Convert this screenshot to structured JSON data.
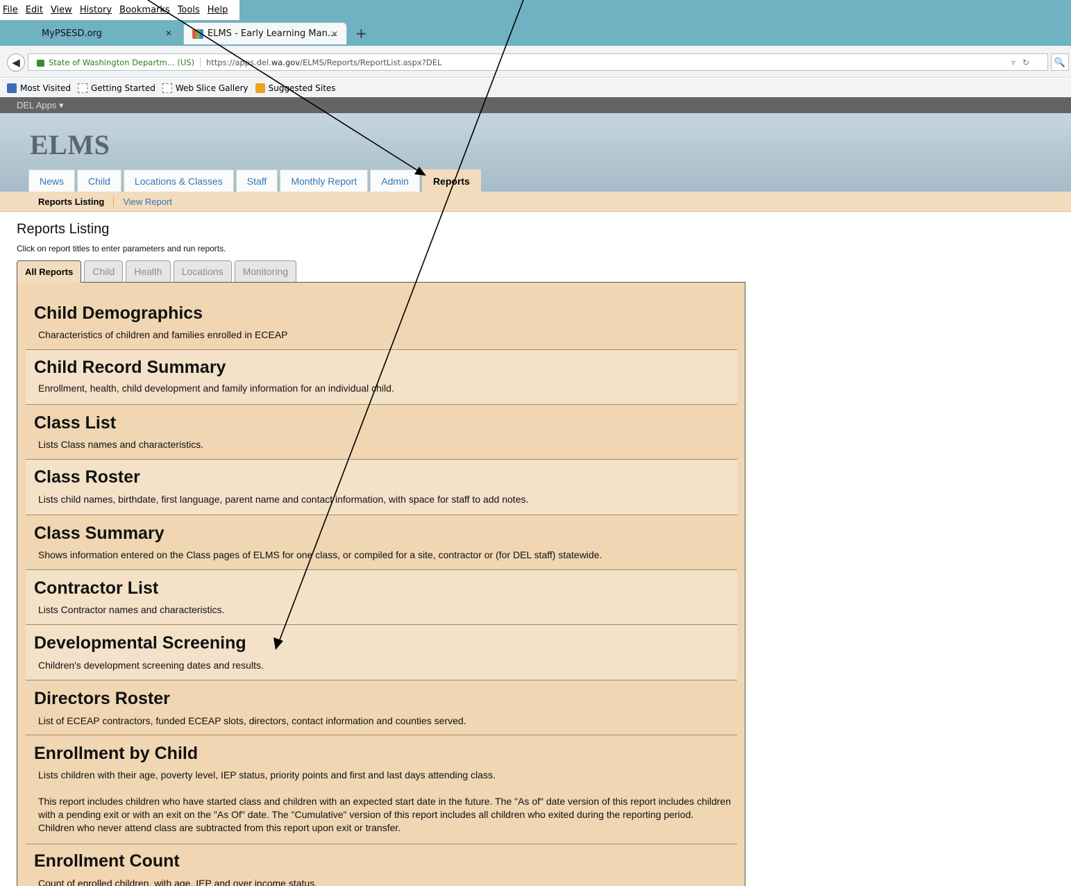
{
  "browser": {
    "menu": [
      "File",
      "Edit",
      "View",
      "History",
      "Bookmarks",
      "Tools",
      "Help"
    ],
    "tabs": [
      {
        "label": "MyPSESD.org"
      },
      {
        "label": "ELMS - Early Learning Man..."
      }
    ],
    "new_tab": "+",
    "identity": "State of Washington Departm... (US)",
    "url_prefix": "https://apps.del.",
    "url_domain": "wa.gov",
    "url_suffix": "/ELMS/Reports/ReportList.aspx?DEL",
    "bookmarks": [
      "Most Visited",
      "Getting Started",
      "Web Slice Gallery",
      "Suggested Sites"
    ]
  },
  "site": {
    "apps_menu": "DEL Apps ▾",
    "logo": "ELMS",
    "nav": [
      "News",
      "Child",
      "Locations & Classes",
      "Staff",
      "Monthly Report",
      "Admin",
      "Reports"
    ],
    "subnav": {
      "current": "Reports Listing",
      "link": "View Report"
    }
  },
  "page": {
    "title": "Reports Listing",
    "instructions": "Click on report titles to enter parameters and run reports.",
    "report_tabs": [
      "All Reports",
      "Child",
      "Health",
      "Locations",
      "Monitoring"
    ],
    "reports": [
      {
        "title": "Child Demographics",
        "desc": "Characteristics of children and families enrolled in ECEAP"
      },
      {
        "title": "Child Record Summary",
        "desc": "Enrollment, health, child development and family information for an individual child."
      },
      {
        "title": "Class List",
        "desc": "Lists Class names and characteristics."
      },
      {
        "title": "Class Roster",
        "desc": "Lists child names, birthdate, first language, parent name and contact information, with space for staff to add notes."
      },
      {
        "title": "Class Summary",
        "desc": "Shows information entered on the Class pages of ELMS for one class, or compiled for a site, contractor or (for DEL staff) statewide."
      },
      {
        "title": "Contractor List",
        "desc": "Lists Contractor names and characteristics."
      },
      {
        "title": "Developmental Screening",
        "desc": "Children's development screening dates and results."
      },
      {
        "title": "Directors Roster",
        "desc": "List of ECEAP contractors, funded ECEAP slots, directors, contact information and counties served."
      },
      {
        "title": "Enrollment by Child",
        "desc": "Lists children with their age, poverty level, IEP status, priority points and first and last days attending class.",
        "note": "This report includes children who have started class and children with an expected start date in the future. The \"As of\" date version of this report includes children with a pending exit or with an exit on the \"As Of\" date. The \"Cumulative\" version of this report includes all children who exited during the reporting period. Children who never attend class are subtracted from this report upon exit or transfer."
      },
      {
        "title": "Enrollment Count",
        "desc": "Count of enrolled children, with age, IEP and over income status."
      }
    ]
  }
}
